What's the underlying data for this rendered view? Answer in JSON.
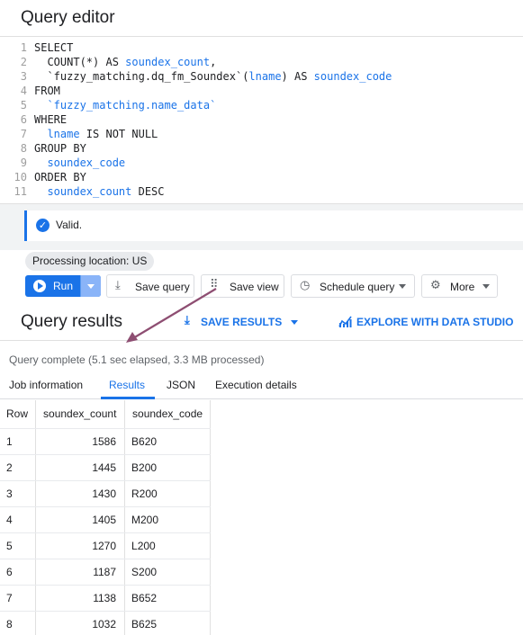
{
  "editor": {
    "title": "Query editor",
    "lines": [
      {
        "num": "1",
        "parts": [
          {
            "t": "SELECT",
            "c": "kw"
          }
        ]
      },
      {
        "num": "2",
        "parts": [
          {
            "t": "  COUNT(*) AS ",
            "c": "kw"
          },
          {
            "t": "soundex_count",
            "c": "id"
          },
          {
            "t": ",",
            "c": "kw"
          }
        ]
      },
      {
        "num": "3",
        "parts": [
          {
            "t": "  `fuzzy_matching.dq_fm_Soundex`(",
            "c": "kw"
          },
          {
            "t": "lname",
            "c": "id"
          },
          {
            "t": ") AS ",
            "c": "kw"
          },
          {
            "t": "soundex_code",
            "c": "id"
          }
        ]
      },
      {
        "num": "4",
        "parts": [
          {
            "t": "FROM",
            "c": "kw"
          }
        ]
      },
      {
        "num": "5",
        "parts": [
          {
            "t": "  `fuzzy_matching.name_data`",
            "c": "id"
          }
        ]
      },
      {
        "num": "6",
        "parts": [
          {
            "t": "WHERE",
            "c": "kw"
          }
        ]
      },
      {
        "num": "7",
        "parts": [
          {
            "t": "  ",
            "c": "kw"
          },
          {
            "t": "lname",
            "c": "id"
          },
          {
            "t": " IS NOT NULL",
            "c": "kw"
          }
        ]
      },
      {
        "num": "8",
        "parts": [
          {
            "t": "GROUP BY",
            "c": "kw"
          }
        ]
      },
      {
        "num": "9",
        "parts": [
          {
            "t": "  soundex_code",
            "c": "id"
          }
        ]
      },
      {
        "num": "10",
        "parts": [
          {
            "t": "ORDER BY",
            "c": "kw"
          }
        ]
      },
      {
        "num": "11",
        "parts": [
          {
            "t": "  soundex_count",
            "c": "id"
          },
          {
            "t": " DESC",
            "c": "kw"
          }
        ]
      }
    ]
  },
  "validation": {
    "text": "Valid."
  },
  "processing_location": "Processing location: US",
  "toolbar": {
    "run_label": "Run",
    "save_query_label": "Save query",
    "save_view_label": "Save view",
    "schedule_query_label": "Schedule query",
    "more_label": "More"
  },
  "results": {
    "title": "Query results",
    "save_results_label": "SAVE RESULTS",
    "explore_label": "EXPLORE WITH DATA STUDIO",
    "status": "Query complete (5.1 sec elapsed, 3.3 MB processed)",
    "tabs": [
      "Job information",
      "Results",
      "JSON",
      "Execution details"
    ],
    "active_tab": "Results",
    "columns": [
      "Row",
      "soundex_count",
      "soundex_code"
    ],
    "rows": [
      [
        "1",
        "1586",
        "B620"
      ],
      [
        "2",
        "1445",
        "B200"
      ],
      [
        "3",
        "1430",
        "R200"
      ],
      [
        "4",
        "1405",
        "M200"
      ],
      [
        "5",
        "1270",
        "L200"
      ],
      [
        "6",
        "1187",
        "S200"
      ],
      [
        "7",
        "1138",
        "B652"
      ],
      [
        "8",
        "1032",
        "B625"
      ]
    ]
  },
  "colors": {
    "accent": "#1a73e8",
    "annotation_arrow": "#8e4e72"
  }
}
